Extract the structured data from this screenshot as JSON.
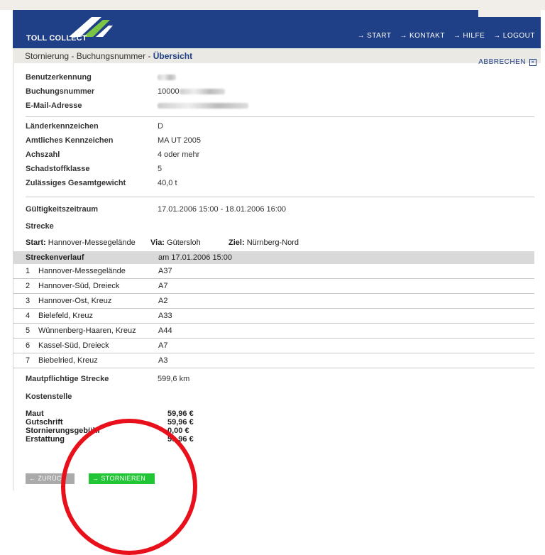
{
  "header": {
    "logo_text": "TOLL COLLECT",
    "nav": [
      "START",
      "KONTAKT",
      "HILFE",
      "LOGOUT"
    ]
  },
  "breadcrumb": {
    "path": "Stornierung - Buchungsnummer - ",
    "current": "Übersicht"
  },
  "cancel_label": "ABBRECHEN",
  "account": [
    {
      "label": "Benutzerkennung",
      "value": ""
    },
    {
      "label": "Buchungsnummer",
      "value": "10000"
    },
    {
      "label": "E-Mail-Adresse",
      "value": ""
    }
  ],
  "vehicle": [
    {
      "label": "Länderkennzeichen",
      "value": "D"
    },
    {
      "label": "Amtliches Kennzeichen",
      "value": "MA UT 2005"
    },
    {
      "label": "Achszahl",
      "value": "4 oder mehr"
    },
    {
      "label": "Schadstoffklasse",
      "value": "5"
    },
    {
      "label": "Zulässiges Gesamtgewicht",
      "value": "40,0 t"
    }
  ],
  "validity": {
    "label": "Gültigkeitszeitraum",
    "value": "17.01.2006 15:00 - 18.01.2006 16:00"
  },
  "strecke": {
    "label": "Strecke",
    "start_label": "Start:",
    "start": "Hannover-Messegelände",
    "via_label": "Via:",
    "via": "Gütersloh",
    "ziel_label": "Ziel:",
    "ziel": "Nürnberg-Nord"
  },
  "route": {
    "header_label": "Streckenverlauf",
    "header_value": "am 17.01.2006 15:00",
    "rows": [
      {
        "n": "1",
        "place": "Hannover-Messegelände",
        "road": "A37"
      },
      {
        "n": "2",
        "place": "Hannover-Süd, Dreieck",
        "road": "A7"
      },
      {
        "n": "3",
        "place": "Hannover-Ost, Kreuz",
        "road": "A2"
      },
      {
        "n": "4",
        "place": "Bielefeld, Kreuz",
        "road": "A33"
      },
      {
        "n": "5",
        "place": "Wünnenberg-Haaren, Kreuz",
        "road": "A44"
      },
      {
        "n": "6",
        "place": "Kassel-Süd, Dreieck",
        "road": "A7"
      },
      {
        "n": "7",
        "place": "Biebelried, Kreuz",
        "road": "A3"
      }
    ]
  },
  "toll_distance": {
    "label": "Mautpflichtige Strecke",
    "value": "599,6 km"
  },
  "costs": {
    "title": "Kostenstelle",
    "rows": [
      {
        "label": "Maut",
        "value": "59,96 €"
      },
      {
        "label": "Gutschrift",
        "value": "59,96 €"
      },
      {
        "label": "Stornierungsgebühr",
        "value": "0,00 €"
      },
      {
        "label": "Erstattung",
        "value": "59,96 €"
      }
    ]
  },
  "buttons": {
    "back": "ZURÜCK",
    "cancel_booking": "STORNIEREN"
  },
  "colors": {
    "header": "#1f3f86",
    "accent_green": "#22c535",
    "annotation_circle": "#e8101a"
  }
}
